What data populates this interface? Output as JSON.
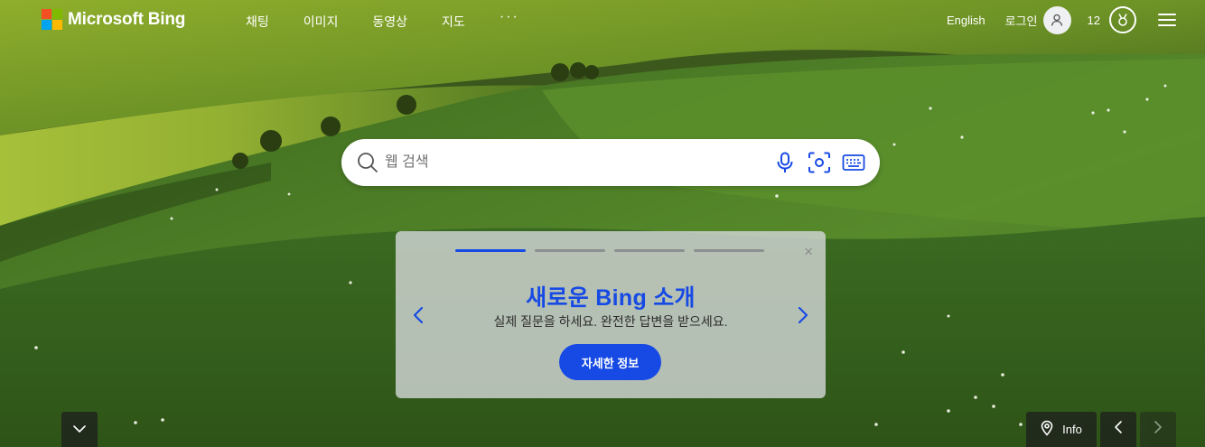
{
  "brand": {
    "name": "Microsoft Bing",
    "logo_colors": [
      "#f25022",
      "#7fba00",
      "#00a4ef",
      "#ffb900"
    ]
  },
  "nav": {
    "items": [
      {
        "label": "채팅"
      },
      {
        "label": "이미지"
      },
      {
        "label": "동영상"
      },
      {
        "label": "지도"
      }
    ],
    "more_label": "···"
  },
  "header_right": {
    "language": "English",
    "login_label": "로그인",
    "reward_points": "12",
    "avatar_icon": "user-icon",
    "rewards_icon": "medal-icon",
    "menu_icon": "hamburger-icon"
  },
  "search": {
    "placeholder": "웹 검색",
    "value": "",
    "tools": [
      "microphone-icon",
      "visual-search-icon",
      "keyboard-icon"
    ],
    "accent_color": "#174ae4"
  },
  "promo": {
    "title": "새로운 Bing 소개",
    "subtitle": "실제 질문을 하세요. 완전한 답변을 받으세요.",
    "button_label": "자세한 정보",
    "close_label": "×",
    "progress_total": 4,
    "progress_active": 1
  },
  "bottom": {
    "info_label": "Info",
    "scroll_icon": "chevron-down-icon",
    "location_icon": "location-pin-icon"
  }
}
